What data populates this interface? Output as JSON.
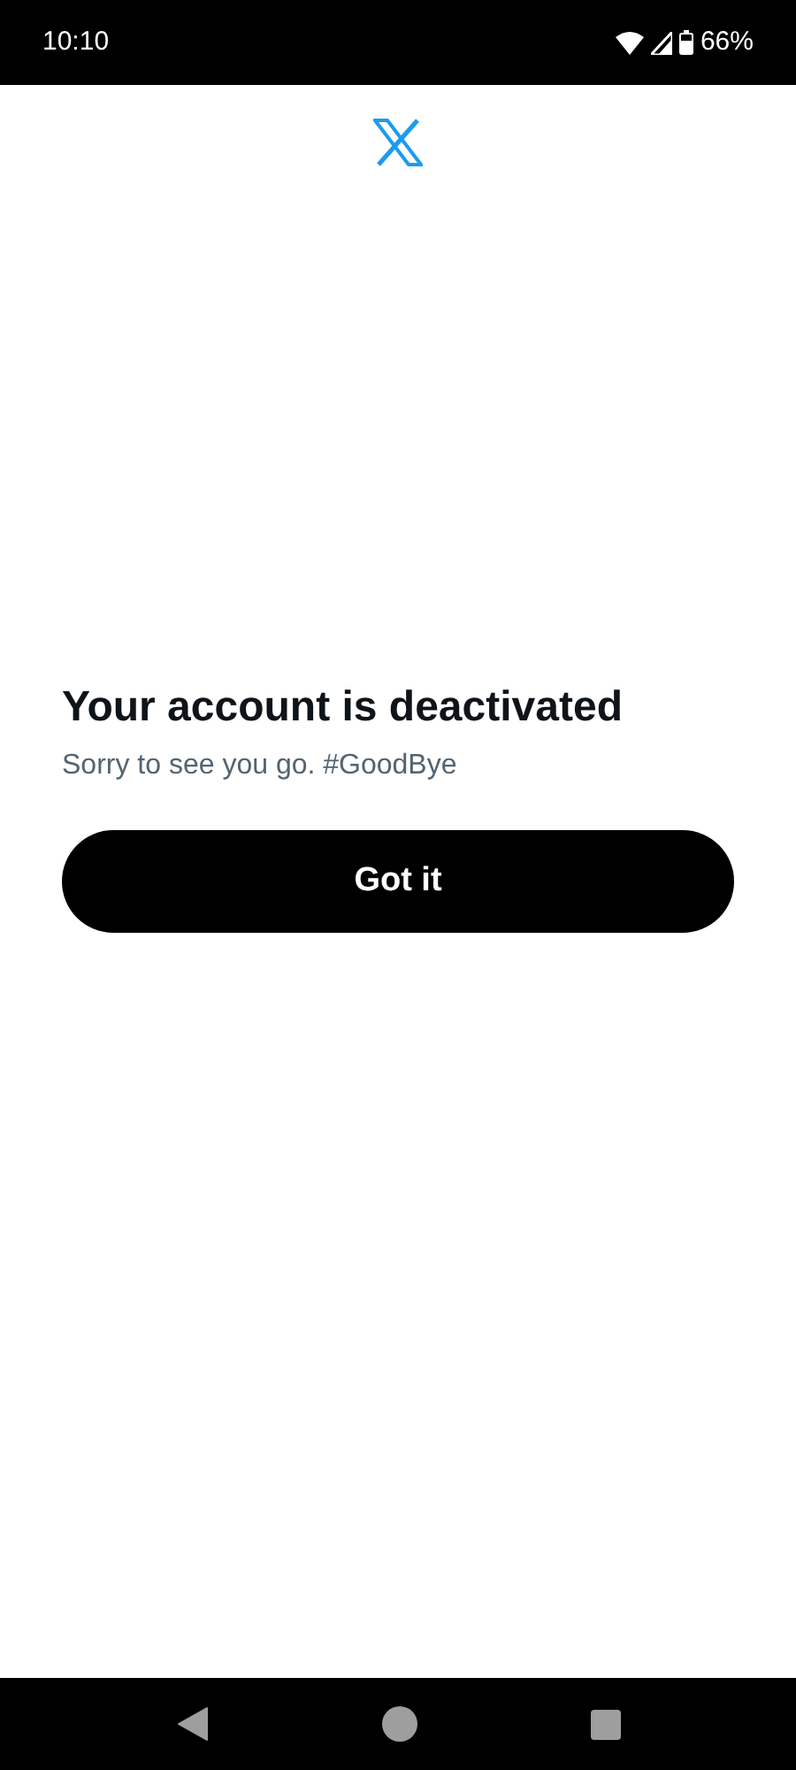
{
  "status_bar": {
    "time": "10:10",
    "battery": "66%"
  },
  "title": "Your account is deactivated",
  "message": "Sorry to see you go. #GoodBye",
  "button": "Got it"
}
